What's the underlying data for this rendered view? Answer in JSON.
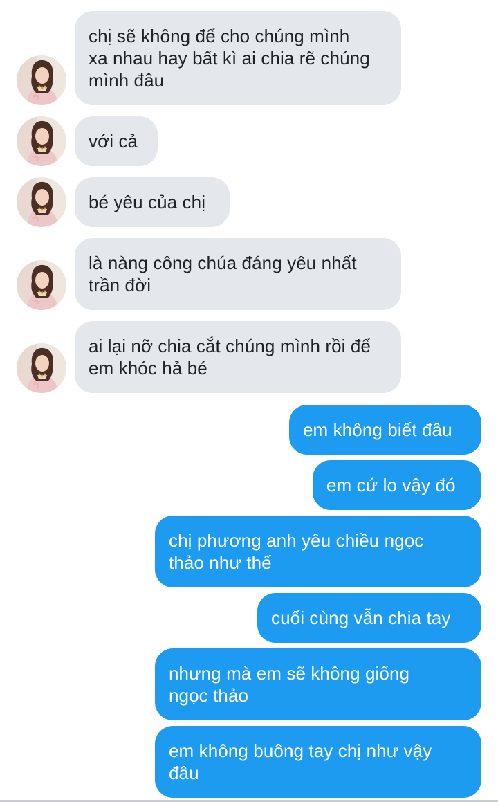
{
  "conversation": {
    "incoming": [
      {
        "text": "chị sẽ không để cho chúng mình\nxa nhau hay bất kì ai chia rẽ chúng\nmình đâu"
      },
      {
        "text": "với cả"
      },
      {
        "text": "bé yêu của chị"
      },
      {
        "text": "là nàng công chúa đáng yêu nhất\ntrần đời"
      },
      {
        "text": "ai lại nỡ chia cắt chúng mình rồi để\nem khóc hả bé"
      }
    ],
    "outgoing": [
      {
        "text": "em không biết đâu"
      },
      {
        "text": "em cứ lo vậy đó"
      },
      {
        "text": "chị phương anh yêu chiều ngọc\nthảo như thế"
      },
      {
        "text": "cuối cùng vẫn chia tay"
      },
      {
        "text": "nhưng mà em sẽ không giống\nngọc thảo"
      },
      {
        "text": "em không buông tay chị như vậy\nđâu"
      }
    ]
  },
  "colors": {
    "incoming_bubble": "#e4e8ec",
    "outgoing_bubble": "#1d9bf0",
    "incoming_text": "#1f2327",
    "outgoing_text": "#ffffff"
  },
  "icons": {
    "avatar": "contact-avatar-photo"
  }
}
